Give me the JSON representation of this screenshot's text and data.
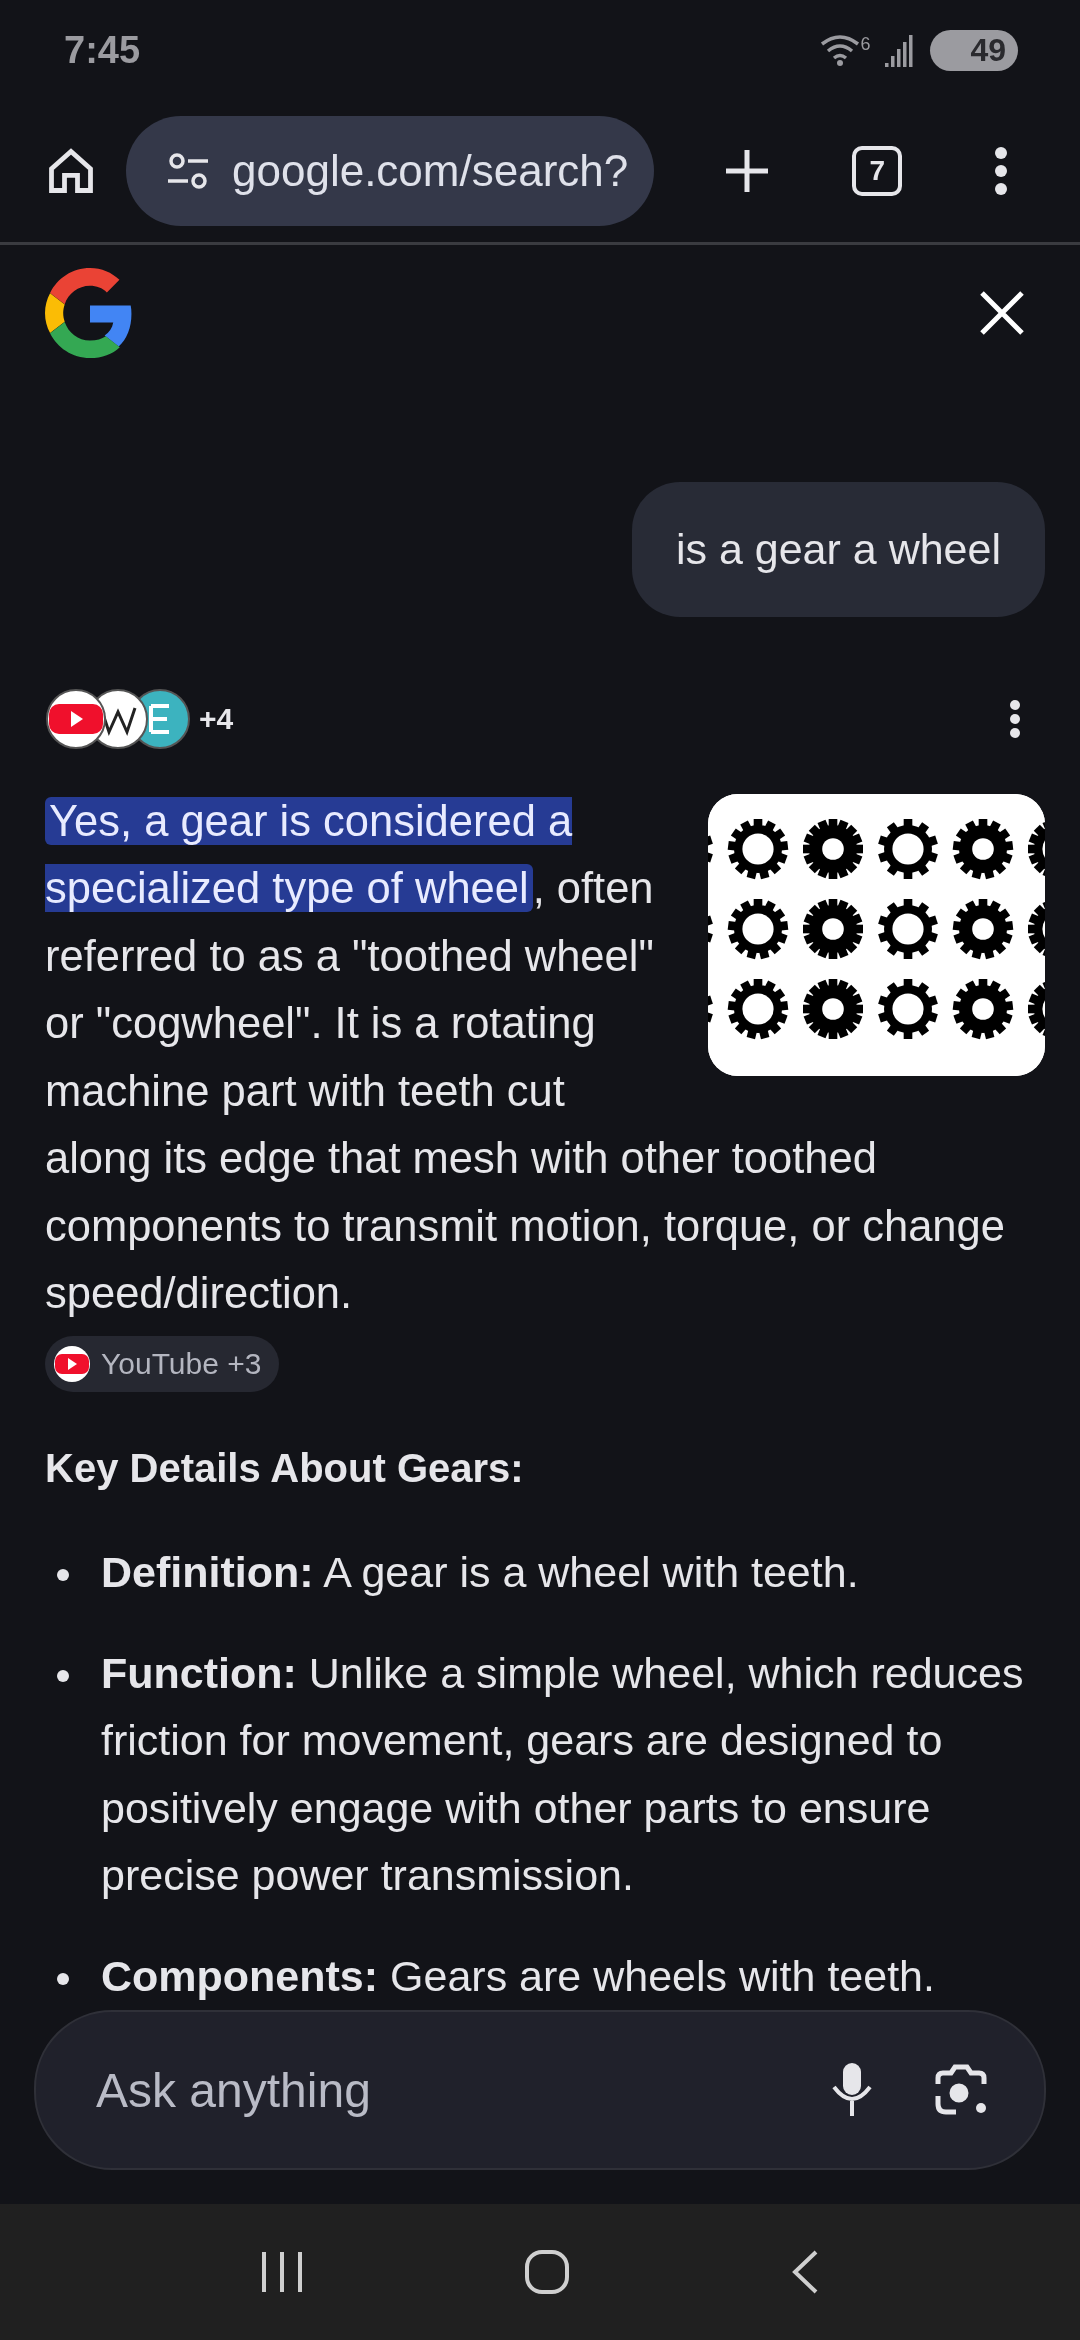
{
  "status_bar": {
    "time": "7:45",
    "wifi_label": "6",
    "battery": "49"
  },
  "toolbar": {
    "url": "google.com/search?",
    "tab_count": "7"
  },
  "query": "is a gear a wheel",
  "sources": {
    "more": "+4",
    "icons": [
      {
        "kind": "youtube"
      },
      {
        "kind": "wiki"
      },
      {
        "kind": "teal"
      }
    ]
  },
  "answer": {
    "highlight": "Yes, a gear is considered a specialized type of wheel",
    "text": ", often referred to as a \"toothed wheel\" or \"cogwheel\". It is a rotating machine part with teeth cut along its edge that mesh with other toothed components to transmit motion, torque, or change speed/direction.",
    "citation": "YouTube +3"
  },
  "heading": "Key Details About Gears:",
  "bullets": [
    {
      "term": "Definition:",
      "text": "A gear is a wheel with teeth."
    },
    {
      "term": "Function:",
      "text": "Unlike a simple wheel, which reduces friction for movement, gears are designed to positively engage with other parts to ensure precise power transmission."
    },
    {
      "term": "Components:",
      "text": "Gears are wheels with teeth."
    }
  ],
  "input": {
    "placeholder": "Ask anything"
  }
}
